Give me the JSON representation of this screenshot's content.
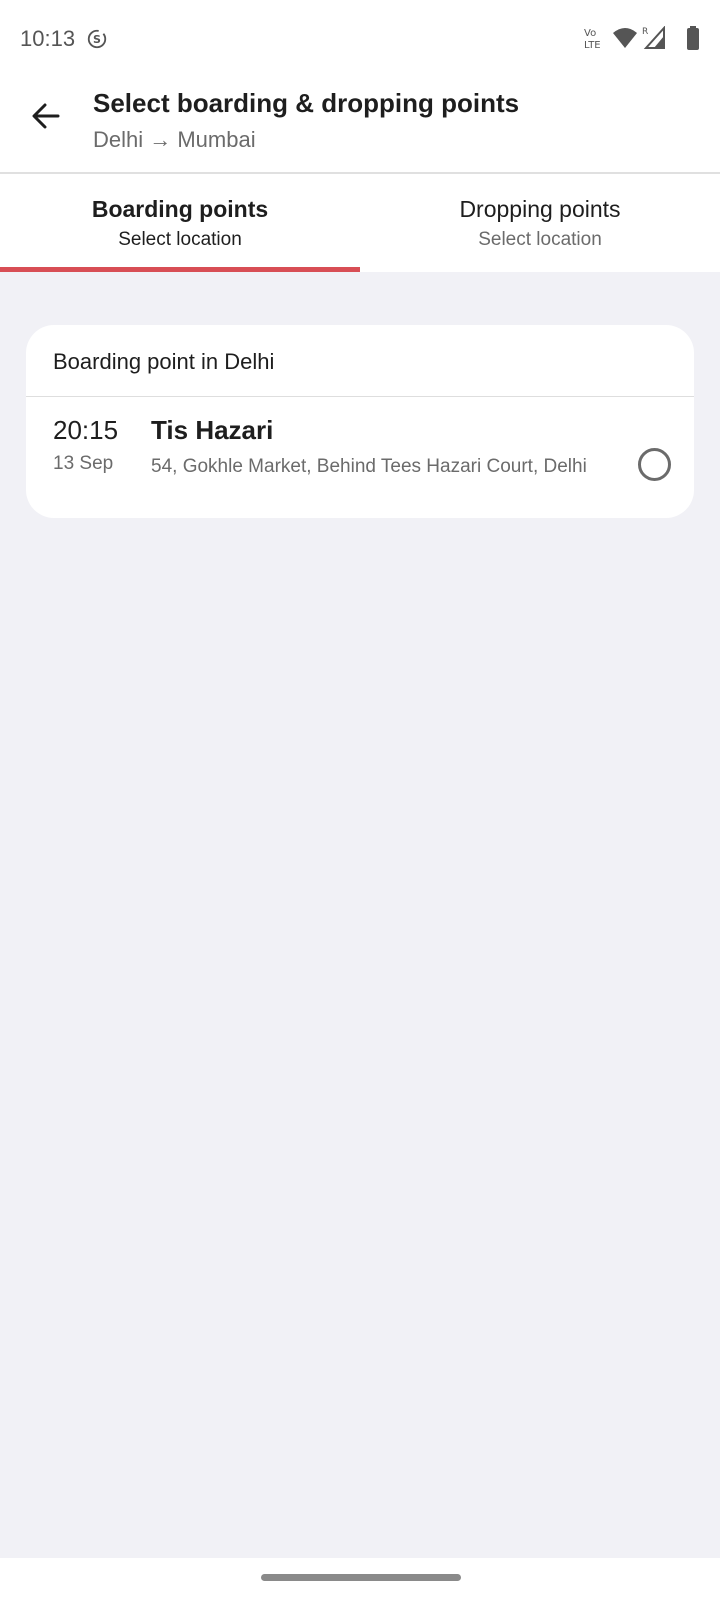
{
  "status_bar": {
    "time": "10:13",
    "icons": [
      "sync-icon",
      "volte-icon",
      "wifi-icon",
      "signal-icon",
      "battery-icon"
    ],
    "volte_line1": "Vo",
    "volte_line2": "LTE",
    "roaming": "R"
  },
  "header": {
    "back_icon": "arrow-left-icon",
    "title": "Select boarding & dropping points",
    "subtitle": "Delhi → Mumbai"
  },
  "tabs": [
    {
      "label": "Boarding points",
      "sub": "Select location",
      "selected": true
    },
    {
      "label": "Dropping points",
      "sub": "Select location",
      "selected": false
    }
  ],
  "accent_color": "#d84e55",
  "boarding_card": {
    "heading": "Boarding point in Delhi",
    "points": [
      {
        "time": "20:15",
        "date": "13 Sep",
        "name": "Tis Hazari",
        "address": "54, Gokhle Market, Behind Tees Hazari Court, Delhi",
        "selected": false
      }
    ]
  }
}
